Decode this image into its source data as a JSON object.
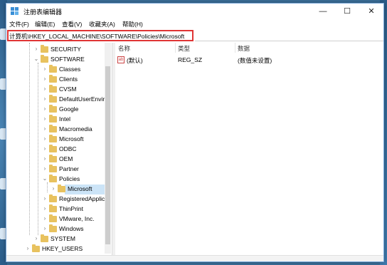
{
  "window": {
    "title": "注册表编辑器"
  },
  "controls": {
    "minimize": "—",
    "maximize": "☐",
    "close": "✕"
  },
  "menu": [
    "文件(F)",
    "编辑(E)",
    "查看(V)",
    "收藏夹(A)",
    "帮助(H)"
  ],
  "address": "计算机\\HKEY_LOCAL_MACHINE\\SOFTWARE\\Policies\\Microsoft",
  "tree": {
    "items": [
      {
        "label": "SECURITY",
        "expander": "›"
      },
      {
        "label": "SOFTWARE",
        "expander": "⌄"
      },
      {
        "label": "Classes",
        "expander": "›"
      },
      {
        "label": "Clients",
        "expander": "›"
      },
      {
        "label": "CVSM",
        "expander": "›"
      },
      {
        "label": "DefaultUserEnviro",
        "expander": "›"
      },
      {
        "label": "Google",
        "expander": "›"
      },
      {
        "label": "Intel",
        "expander": "›"
      },
      {
        "label": "Macromedia",
        "expander": "›"
      },
      {
        "label": "Microsoft",
        "expander": "›"
      },
      {
        "label": "ODBC",
        "expander": "›"
      },
      {
        "label": "OEM",
        "expander": "›"
      },
      {
        "label": "Partner",
        "expander": "›"
      },
      {
        "label": "Policies",
        "expander": "⌄"
      },
      {
        "label": "Microsoft",
        "expander": "›",
        "selected": true
      },
      {
        "label": "RegisteredApplica",
        "expander": "›"
      },
      {
        "label": "ThinPrint",
        "expander": "›"
      },
      {
        "label": "VMware, Inc.",
        "expander": "›"
      },
      {
        "label": "Windows",
        "expander": "›"
      },
      {
        "label": "SYSTEM",
        "expander": "›"
      },
      {
        "label": "HKEY_USERS",
        "expander": "›"
      }
    ]
  },
  "list": {
    "headers": [
      "名称",
      "类型",
      "数据"
    ],
    "rows": [
      {
        "icon": "ab",
        "name": "(默认)",
        "type": "REG_SZ",
        "data": "(数值未设置)"
      }
    ]
  },
  "colors": {
    "selection": "#cce4f7",
    "highlight_border": "#e03535",
    "folder": "#e8c25f"
  }
}
